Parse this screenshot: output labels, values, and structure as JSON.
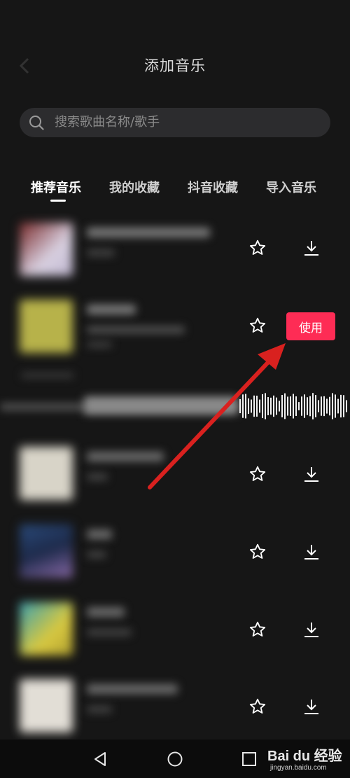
{
  "header": {
    "title": "添加音乐"
  },
  "search": {
    "placeholder": "搜索歌曲名称/歌手"
  },
  "tabs": [
    {
      "label": "推荐音乐",
      "active": true
    },
    {
      "label": "我的收藏",
      "active": false
    },
    {
      "label": "抖音收藏",
      "active": false
    },
    {
      "label": "导入音乐",
      "active": false
    }
  ],
  "use_button": {
    "label": "使用"
  },
  "colors": {
    "accent": "#fe2c55",
    "background": "#161616"
  },
  "icons": [
    "back-arrow-icon",
    "search-icon",
    "star-icon",
    "download-icon",
    "nav-back-icon",
    "nav-home-icon",
    "nav-recents-icon"
  ],
  "watermark": {
    "brand": "Bai du 经验",
    "url": "jingyan.baidu.com"
  }
}
